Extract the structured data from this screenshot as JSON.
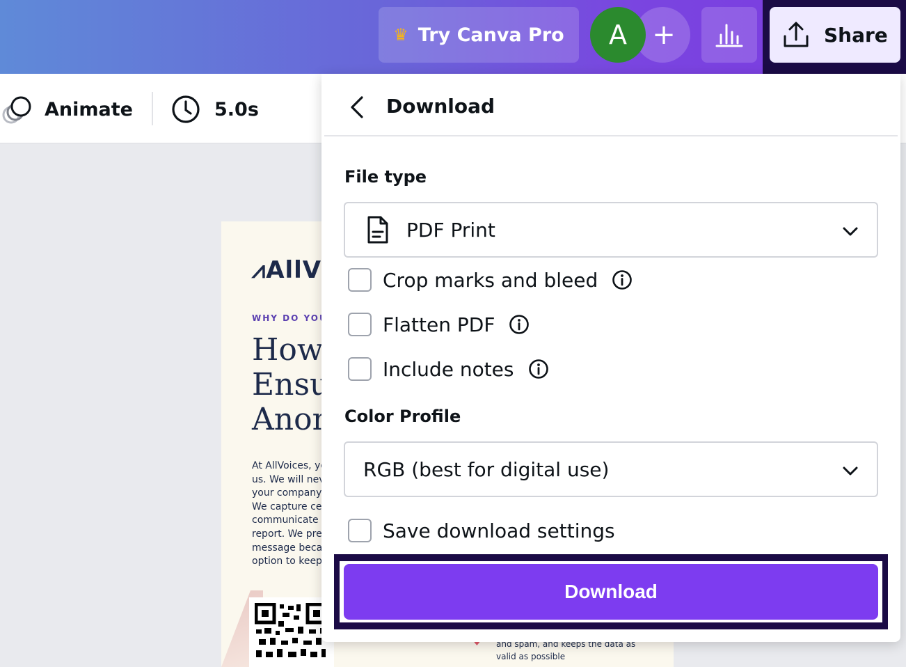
{
  "header": {
    "pro_label": "Try Canva Pro",
    "avatar_initial": "A",
    "add_symbol": "+",
    "share_label": "Share",
    "icons": [
      "crown-icon",
      "bar-chart-icon",
      "upload-icon"
    ]
  },
  "toolbar": {
    "animate_label": "Animate",
    "duration_label": "5.0s"
  },
  "canvas": {
    "logo_text": "AllV",
    "eyebrow": "WHY DO YOU N",
    "headline_lines": [
      "How",
      "Ensur",
      "Anon"
    ],
    "body_lines": [
      "At AllVoices, yo",
      "us. We will neve",
      "your company, a",
      "We capture cell",
      "communicate w",
      "report. We pref",
      "message becaus",
      "option to keep y"
    ],
    "footnote_lines": [
      "and spam, and keeps the data as",
      "valid as possible"
    ]
  },
  "download_panel": {
    "title": "Download",
    "file_type_label": "File type",
    "file_type_value": "PDF Print",
    "options": [
      {
        "label": "Crop marks and bleed",
        "checked": false,
        "has_info": true
      },
      {
        "label": "Flatten PDF",
        "checked": false,
        "has_info": true
      },
      {
        "label": "Include notes",
        "checked": false,
        "has_info": true
      }
    ],
    "color_profile_label": "Color Profile",
    "color_profile_value": "RGB (best for digital use)",
    "save_settings_label": "Save download settings",
    "download_button_label": "Download"
  },
  "colors": {
    "accent": "#7d3cf0",
    "header_gradient_start": "#5f8ad8",
    "header_gradient_end": "#7c3ae0",
    "avatar_bg": "#2b8a2e",
    "focus_ring": "#1b0b46"
  }
}
